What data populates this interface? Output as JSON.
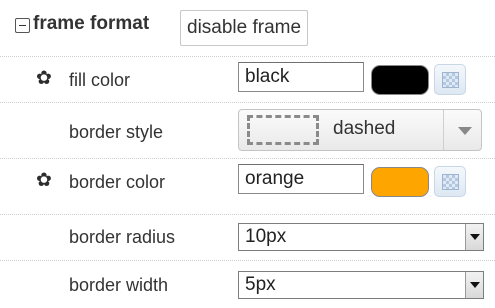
{
  "section": {
    "title": "frame format",
    "disable_button": "disable frame"
  },
  "rows": {
    "fill_color": {
      "label": "fill color",
      "value": "black",
      "swatch": "#000000",
      "gear_icon": "gear-icon"
    },
    "border_style": {
      "label": "border style",
      "value": "dashed"
    },
    "border_color": {
      "label": "border color",
      "value": "orange",
      "swatch": "#ffa500",
      "gear_icon": "gear-icon"
    },
    "border_radius": {
      "label": "border radius",
      "value": "10px"
    },
    "border_width": {
      "label": "border width",
      "value": "5px"
    }
  }
}
